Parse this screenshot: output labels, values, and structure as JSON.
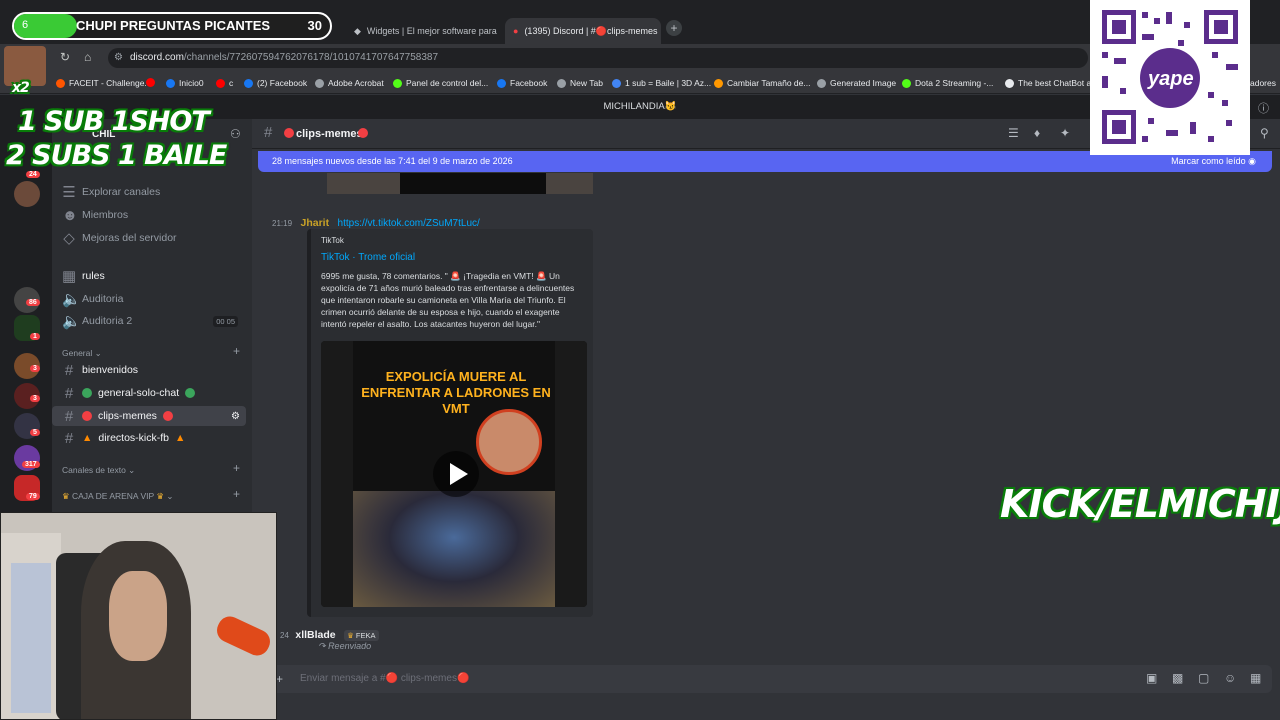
{
  "browser": {
    "tabs": [
      {
        "label": "Widgets | El mejor software para"
      },
      {
        "label": "(1395) Discord | #🔴clips-memes"
      }
    ],
    "url_host": "discord.com",
    "url_path": "/channels/772607594762076178/1010741707647758387",
    "bookmarks": [
      "FACEIT - Challenge...",
      "Inicio0",
      "c",
      "(2) Facebook",
      "Adobe Acrobat",
      "Panel de control del...",
      "Facebook",
      "New Tab",
      "1 sub = Baile | 3D Az...",
      "Cambiar Tamaño de...",
      "Generated Image",
      "Dota 2 Streaming -...",
      "The best ChatBot an",
      "adores"
    ]
  },
  "discord": {
    "server_name": "MICHILANDIA😼",
    "server_short": "CHIL",
    "server_badges": [
      "24",
      "86",
      "1",
      "3",
      "3",
      "5",
      "317",
      "79"
    ],
    "sidebar": {
      "top_items": [
        "Explorar canales",
        "Miembros",
        "Mejoras del servidor"
      ],
      "rules": "rules",
      "voice": [
        "Auditoria",
        "Auditoria 2"
      ],
      "voice_counter": [
        "00",
        "05"
      ],
      "cat_general": "General",
      "channels": [
        "bienvenidos",
        "general-solo-chat",
        "clips-memes",
        "directos-kick-fb"
      ],
      "cat_text": "Canales de texto",
      "cat_arena": "CAJA DE ARENA VIP"
    },
    "header": {
      "channel": "clips-memes"
    },
    "banner": {
      "text": "28 mensajes nuevos desde las 7:41 del 9 de marzo de 2026",
      "action": "Marcar como leído"
    },
    "messages": [
      {
        "time": "21:19",
        "author": "Jharit",
        "link": "https://vt.tiktok.com/ZSuM7tLuc/"
      },
      {
        "time": "24",
        "author": "xllBlade",
        "tag": "FEKA",
        "forwarded": "Reenviado"
      }
    ],
    "embed": {
      "provider": "TikTok",
      "title": "TikTok · Trome oficial",
      "description": "6995 me gusta, 78 comentarios. \" 🚨 ¡Tragedia en VMT! 🚨 Un expolicía de 71 años murió baleado tras enfrentarse a delincuentes que intentaron robarle su camioneta en Villa María del Triunfo. El crimen ocurrió delante de su esposa e hijo, cuando el exagente intentó repeler el asalto. Los atacantes huyeron del lugar.\"",
      "video_headline": "EXPOLICÍA MUERE AL ENFRENTAR A LADRONES EN VMT"
    },
    "composer": {
      "placeholder": "Enviar mensaje a #🔴 clips-memes🔴"
    }
  },
  "overlay": {
    "alert": {
      "number": "6",
      "text": "CHUPI PREGUNTAS PICANTES",
      "count": "30",
      "progress": 0.2
    },
    "multiplier": "x2",
    "promo_line1": "1 SUB 1SHOT",
    "promo_line2": "2 SUBS 1 BAILE",
    "kick": "KICK/ELMICHIJ",
    "qr_brand": "yape"
  },
  "colors": {
    "blurple": "#5865f2",
    "link": "#00a8fc",
    "green": "#3aca35"
  }
}
